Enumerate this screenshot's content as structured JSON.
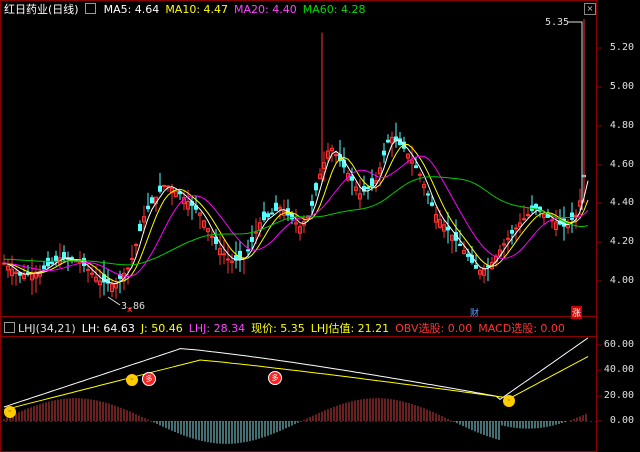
{
  "header": {
    "title": "红日药业(日线)",
    "ma5_label": "MA5: 4.64",
    "ma10_label": "MA10: 4.47",
    "ma20_label": "MA20: 4.40",
    "ma60_label": "MA60: 4.28"
  },
  "main_axis": {
    "ticks": [
      "5.20",
      "5.00",
      "4.80",
      "4.60",
      "4.40",
      "4.20",
      "4.00"
    ]
  },
  "annotations": {
    "high": "5.35",
    "low": "3.86",
    "marker_sell": "财",
    "marker_up": "涨"
  },
  "indicator_header": {
    "name": "LHJ(34,21)",
    "lh": "LH: 64.63",
    "j": "J: 50.46",
    "lhj": "LHJ: 28.34",
    "price": "现价: 5.35",
    "est": "LHJ估值: 21.21",
    "obv": "OBV选股: 0.00",
    "macd": "MACD选股: 0.00"
  },
  "indicator_axis": {
    "ticks": [
      "60.00",
      "40.00",
      "20.00",
      "0.00"
    ]
  },
  "icons": {
    "smile": "smile-icon",
    "duo": "duo-badge-icon"
  },
  "colors": {
    "up": "#ff3333",
    "down": "#54ffff",
    "ma5": "#ffffff",
    "ma10": "#ffff00",
    "ma20": "#ff00ff",
    "ma60": "#00cc00",
    "frame": "#b00000"
  }
}
